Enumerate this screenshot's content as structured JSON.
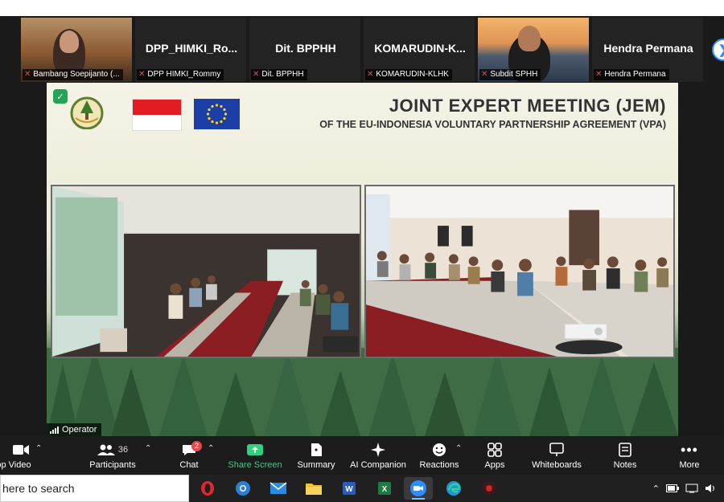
{
  "participants": [
    {
      "name": "",
      "label": "Bambang Soepijanto (...",
      "muted": true,
      "has_video": true
    },
    {
      "name": "DPP_HIMKI_Ro...",
      "label": "DPP HIMKI_Rommy",
      "muted": true,
      "has_video": false
    },
    {
      "name": "Dit. BPPHH",
      "label": "Dit. BPPHH",
      "muted": true,
      "has_video": false
    },
    {
      "name": "KOMARUDIN-K...",
      "label": "KOMARUDIN-KLHK",
      "muted": true,
      "has_video": false
    },
    {
      "name": "",
      "label": "Subdit SPHH",
      "muted": true,
      "has_video": true
    },
    {
      "name": "Hendra Permana",
      "label": "Hendra Permana",
      "muted": true,
      "has_video": false
    }
  ],
  "tile_nav_icon": "chevron-right-icon",
  "shared_slide": {
    "title": "JOINT EXPERT MEETING (JEM)",
    "subtitle": "OF THE EU-INDONESIA VOLUNTARY PARTNERSHIP AGREEMENT (VPA)",
    "active_speaker_label": "Operator"
  },
  "toolbar": {
    "video_label": "op Video",
    "participants_label": "Participants",
    "participants_count": "36",
    "chat_label": "Chat",
    "chat_badge": "2",
    "share_label": "Share Screen",
    "summary_label": "Summary",
    "ai_label": "AI Companion",
    "reactions_label": "Reactions",
    "apps_label": "Apps",
    "whiteboards_label": "Whiteboards",
    "notes_label": "Notes",
    "more_label": "More"
  },
  "taskbar": {
    "search_text": "here to search",
    "apps": [
      "opera-icon",
      "chrome-icon",
      "mail-icon",
      "file-explorer-icon",
      "word-icon",
      "excel-icon",
      "zoom-icon",
      "edge-icon",
      "app-icon"
    ]
  },
  "colors": {
    "share_green": "#2fd07e",
    "muted_red": "#e5484d",
    "zoom_blue": "#2d8cff",
    "toolbar_bg": "#1c1c1c"
  }
}
